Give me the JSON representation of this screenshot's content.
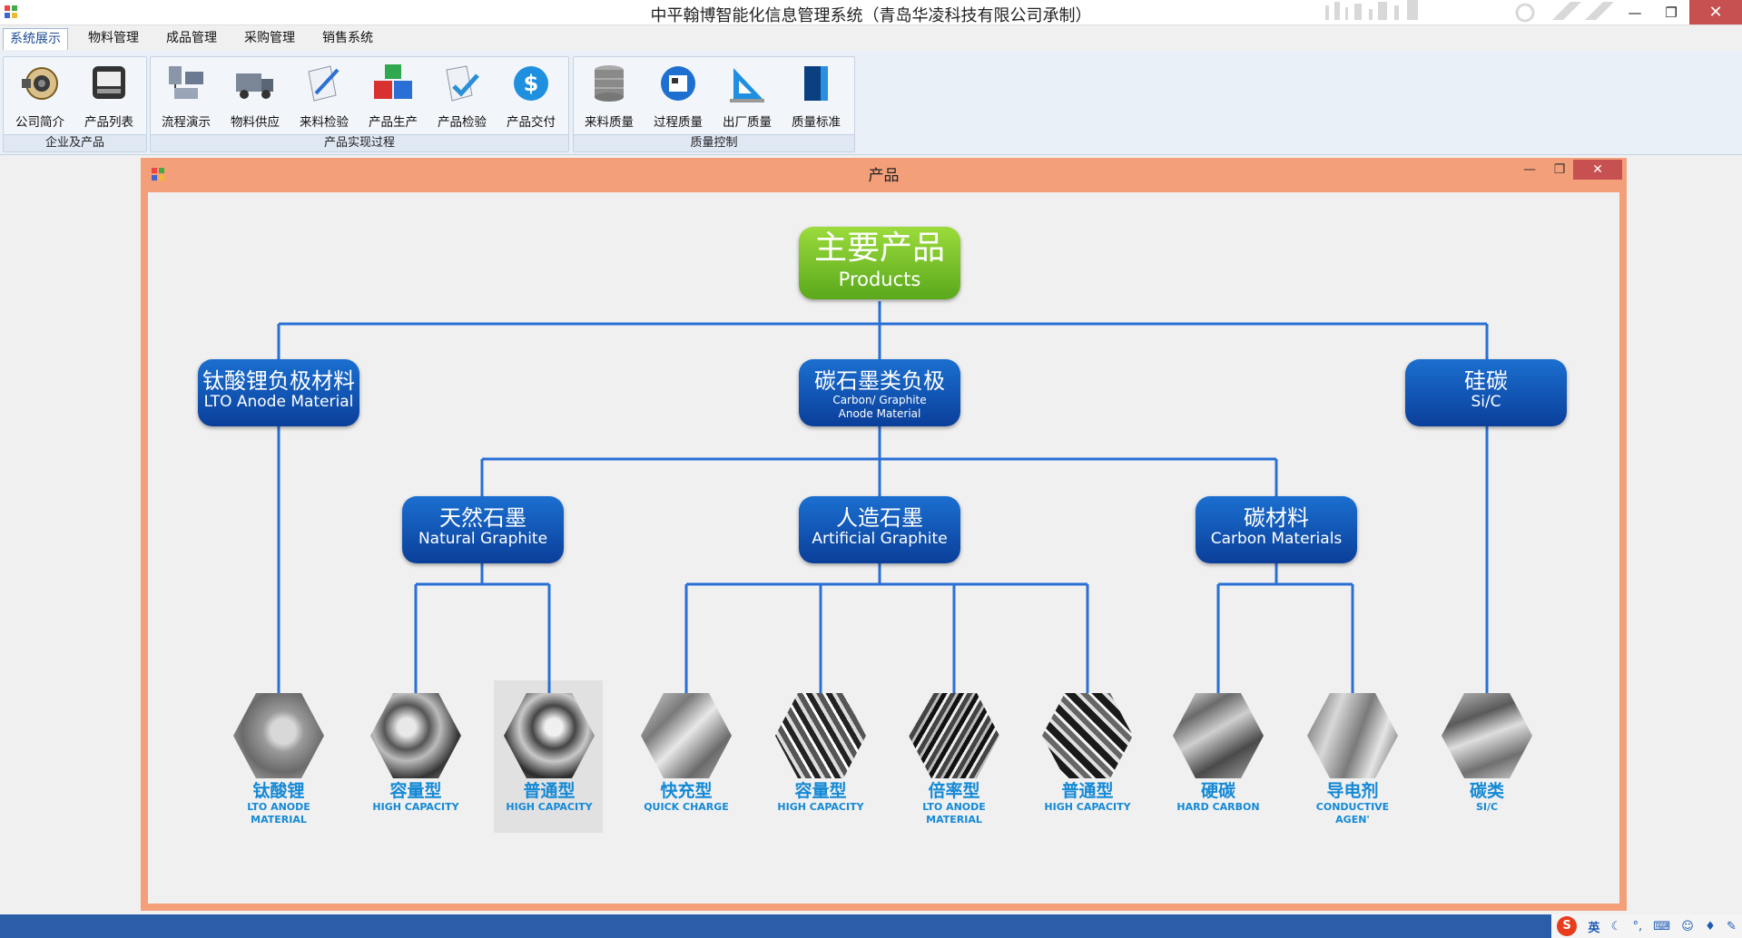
{
  "window": {
    "title": "中平翰博智能化信息管理系统（青岛华凌科技有限公司承制）",
    "min_glyph": "—",
    "max_glyph": "❐",
    "close_glyph": "✕"
  },
  "menu": {
    "items": [
      "系统展示",
      "物料管理",
      "成品管理",
      "采购管理",
      "销售系统"
    ],
    "active_index": 0
  },
  "ribbon": {
    "groups": [
      {
        "label": "企业及产品",
        "buttons": [
          {
            "label": "公司简介",
            "icon": "speaker-icon"
          },
          {
            "label": "产品列表",
            "icon": "screen-icon"
          }
        ]
      },
      {
        "label": "产品实现过程",
        "buttons": [
          {
            "label": "流程演示",
            "icon": "network-icon"
          },
          {
            "label": "物料供应",
            "icon": "truck-icon"
          },
          {
            "label": "来料检验",
            "icon": "document-pen-icon"
          },
          {
            "label": "产品生产",
            "icon": "cubes-icon"
          },
          {
            "label": "产品检验",
            "icon": "check-document-icon"
          },
          {
            "label": "产品交付",
            "icon": "dollar-icon"
          }
        ]
      },
      {
        "label": "质量控制",
        "buttons": [
          {
            "label": "来料质量",
            "icon": "database-icon"
          },
          {
            "label": "过程质量",
            "icon": "globe-icon"
          },
          {
            "label": "出厂质量",
            "icon": "triangle-ruler-icon"
          },
          {
            "label": "质量标准",
            "icon": "book-icon"
          }
        ]
      }
    ]
  },
  "child": {
    "title": "产品",
    "min_glyph": "—",
    "max_glyph": "❐",
    "close_glyph": "✕"
  },
  "diagram": {
    "root": {
      "zh": "主要产品",
      "en": "Products"
    },
    "level1": [
      {
        "zh": "钛酸锂负极材料",
        "en": "LTO Anode Material"
      },
      {
        "zh": "碳石墨类负极",
        "en": "Carbon/ Graphite",
        "en2": "Anode Material"
      },
      {
        "zh": "硅碳",
        "en": "Si/C"
      }
    ],
    "level2": [
      {
        "zh": "天然石墨",
        "en": "Natural Graphite"
      },
      {
        "zh": "人造石墨",
        "en": "Artificial Graphite"
      },
      {
        "zh": "碳材料",
        "en": "Carbon Materials"
      }
    ],
    "products": [
      {
        "zh": "钛酸锂",
        "en": "LTO ANODE",
        "en2": "MATERIAL"
      },
      {
        "zh": "容量型",
        "en": "HIGH CAPACITY"
      },
      {
        "zh": "普通型",
        "en": "HIGH CAPACITY"
      },
      {
        "zh": "快充型",
        "en": "QUICK CHARGE"
      },
      {
        "zh": "容量型",
        "en": "HIGH CAPACITY"
      },
      {
        "zh": "倍率型",
        "en": "LTO ANODE",
        "en2": "MATERIAL"
      },
      {
        "zh": "普通型",
        "en": "HIGH CAPACITY"
      },
      {
        "zh": "硬碳",
        "en": "HARD CARBON"
      },
      {
        "zh": "导电剂",
        "en": "CONDUCTIVE AGEN'"
      },
      {
        "zh": "碳类",
        "en": "SI/C"
      }
    ],
    "selected_product_index": 2
  },
  "taskbar": {
    "ime_logo": "S",
    "ime_lang": "英",
    "ime_icons": [
      "moon-icon",
      "punctuation-icon",
      "keyboard-icon",
      "user-icon",
      "shirt-icon",
      "wrench-icon"
    ]
  },
  "colors": {
    "node_blue": "#0a4fb0",
    "node_green": "#6cbc28",
    "connector": "#2a6fd6",
    "product_text": "#1489d6",
    "child_frame": "#f3a07a",
    "close_red": "#c75050"
  }
}
